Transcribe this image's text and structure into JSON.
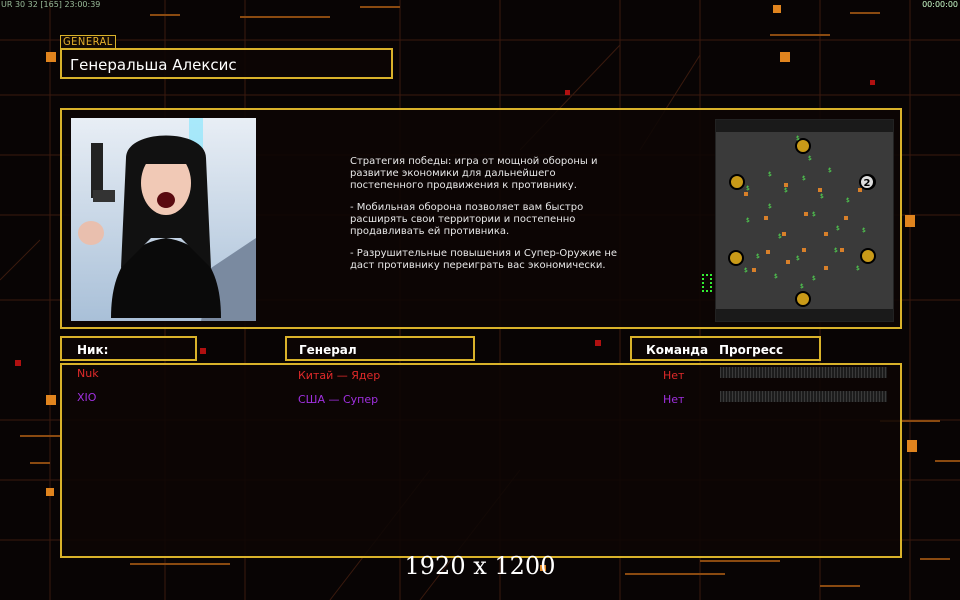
{
  "hud": {
    "left_status": "UR 30 32 [165] 23:00:39",
    "right_time": "00:00:00"
  },
  "general_tag": "GENERAL",
  "general_name": "Генеральша Алексис",
  "description": [
    "Стратегия победы: игра от мощной обороны и\n развитие экономики для дальнейшего\n постепенного продвижения к противнику.",
    "- Мобильная оборона позволяет вам быстро\n расширять свои территории и постепенно\n продавливать ей противника.",
    "- Разрушительные повышения и Супер-Оружие не\n даст противнику переиграть вас экономически."
  ],
  "minimap": {
    "player_marker": "2"
  },
  "table": {
    "headers": {
      "nick": "Ник:",
      "general": "Генерал",
      "team": "Команда",
      "progress": "Прогресс"
    },
    "rows": [
      {
        "nick": "Nuk",
        "general": "Китай — Ядер",
        "team": "Нет",
        "progress": 0,
        "color": "#e02a2a"
      },
      {
        "nick": "XIO",
        "general": "США — Супер",
        "team": "Нет",
        "progress": 0,
        "color": "#a030e0"
      }
    ]
  },
  "resolution_label": "1920 x 1200",
  "colors": {
    "accent": "#d9b22a",
    "background": "#080404",
    "player1": "#e02a2a",
    "player2": "#a030e0"
  }
}
